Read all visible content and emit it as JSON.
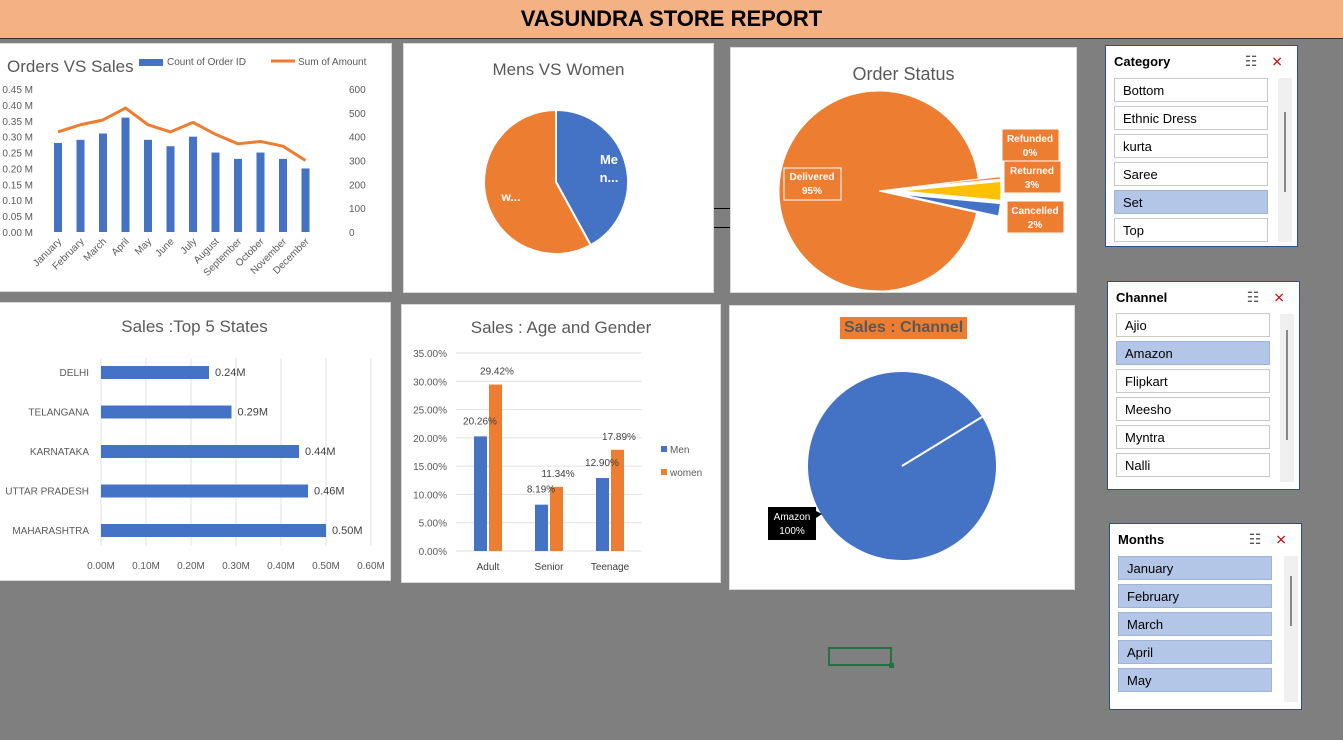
{
  "report_title": "VASUNDRA STORE REPORT",
  "orders_vs_sales": {
    "title": "Orders VS Sales",
    "legend_orders": "Count of Order ID",
    "legend_sales": "Sum of Amount",
    "left_axis": [
      "0.45 M",
      "0.40 M",
      "0.35 M",
      "0.30 M",
      "0.25 M",
      "0.20 M",
      "0.15 M",
      "0.10 M",
      "0.05 M",
      "0.00 M"
    ],
    "right_axis": [
      "600",
      "500",
      "400",
      "300",
      "200",
      "100",
      "0"
    ],
    "months": [
      "January",
      "February",
      "March",
      "April",
      "May",
      "June",
      "July",
      "August",
      "September",
      "October",
      "November",
      "December"
    ],
    "bar_heights_m": [
      0.28,
      0.29,
      0.31,
      0.36,
      0.29,
      0.27,
      0.3,
      0.25,
      0.23,
      0.25,
      0.23,
      0.2
    ],
    "line_values": [
      420,
      450,
      470,
      520,
      450,
      420,
      460,
      410,
      370,
      380,
      360,
      300
    ]
  },
  "mens_vs_women": {
    "title": "Mens VS Women",
    "men_label": "Me n...",
    "women_label": "w...",
    "men_share": 0.42,
    "women_share": 0.58
  },
  "order_status": {
    "title": "Order Status",
    "slices": [
      {
        "name": "Delivered",
        "pct": "95%",
        "value": 95
      },
      {
        "name": "Refunded",
        "pct": "0%",
        "value": 0.4
      },
      {
        "name": "Returned",
        "pct": "3%",
        "value": 3
      },
      {
        "name": "Cancelled",
        "pct": "2%",
        "value": 2
      }
    ]
  },
  "top_states": {
    "title": "Sales :Top 5 States",
    "states": [
      "DELHI",
      "TELANGANA",
      "KARNATAKA",
      "UTTAR PRADESH",
      "MAHARASHTRA"
    ],
    "values": [
      0.24,
      0.29,
      0.44,
      0.46,
      0.5
    ],
    "labels": [
      "0.24M",
      "0.29M",
      "0.44M",
      "0.46M",
      "0.50M"
    ],
    "x_ticks": [
      "0.00M",
      "0.10M",
      "0.20M",
      "0.30M",
      "0.40M",
      "0.50M",
      "0.60M"
    ]
  },
  "age_gender": {
    "title": "Sales : Age and Gender",
    "y_ticks": [
      "35.00%",
      "30.00%",
      "25.00%",
      "20.00%",
      "15.00%",
      "10.00%",
      "5.00%",
      "0.00%"
    ],
    "groups": [
      "Adult",
      "Senior",
      "Teenage"
    ],
    "men": [
      20.26,
      8.19,
      12.9
    ],
    "women": [
      29.42,
      11.34,
      17.89
    ],
    "men_labels": [
      "20.26%",
      "8.19%",
      "12.90%"
    ],
    "women_labels": [
      "29.42%",
      "11.34%",
      "17.89%"
    ],
    "legend_men": "Men",
    "legend_women": "women"
  },
  "sales_channel": {
    "title": "Sales : Channel",
    "label_name": "Amazon",
    "label_pct": "100%"
  },
  "slicers": {
    "category": {
      "title": "Category",
      "items": [
        {
          "label": "Bottom",
          "selected": false
        },
        {
          "label": "Ethnic Dress",
          "selected": false
        },
        {
          "label": "kurta",
          "selected": false
        },
        {
          "label": "Saree",
          "selected": false
        },
        {
          "label": "Set",
          "selected": true
        },
        {
          "label": "Top",
          "selected": false
        }
      ]
    },
    "channel": {
      "title": "Channel",
      "items": [
        {
          "label": "Ajio",
          "selected": false
        },
        {
          "label": "Amazon",
          "selected": true
        },
        {
          "label": "Flipkart",
          "selected": false
        },
        {
          "label": "Meesho",
          "selected": false
        },
        {
          "label": "Myntra",
          "selected": false
        },
        {
          "label": "Nalli",
          "selected": false
        }
      ]
    },
    "months": {
      "title": "Months",
      "items": [
        {
          "label": "January",
          "selected": true
        },
        {
          "label": "February",
          "selected": true
        },
        {
          "label": "March",
          "selected": true
        },
        {
          "label": "April",
          "selected": true
        },
        {
          "label": "May",
          "selected": true
        }
      ]
    }
  },
  "colors": {
    "blue": "#4472c4",
    "orange": "#ed7d31",
    "yellow": "#ffc000",
    "banner": "#f4b183",
    "sheet": "#7f7f7f"
  },
  "icons": {
    "multiselect": "multi-select-icon",
    "clear_filter": "clear-filter-icon"
  }
}
